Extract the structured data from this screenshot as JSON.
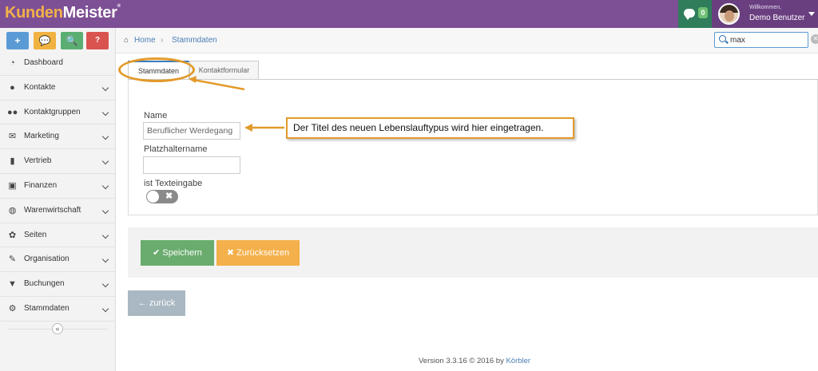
{
  "app": {
    "logo_part1": "Kunden",
    "logo_part2": "Meister",
    "logo_mark": "®"
  },
  "header": {
    "chat_count": "0",
    "welcome": "Willkommen,",
    "user_name": "Demo Benutzer"
  },
  "quick_actions": [
    {
      "label": "+"
    },
    {
      "label": "💬"
    },
    {
      "label": "🔍"
    },
    {
      "label": "?"
    }
  ],
  "sidebar": {
    "items": [
      {
        "label": "Dashboard",
        "icon": "dashboard-icon"
      },
      {
        "label": "Kontakte",
        "icon": "user-icon"
      },
      {
        "label": "Kontaktgruppen",
        "icon": "users-icon"
      },
      {
        "label": "Marketing",
        "icon": "envelope-icon"
      },
      {
        "label": "Vertrieb",
        "icon": "bar-chart-icon"
      },
      {
        "label": "Finanzen",
        "icon": "money-icon"
      },
      {
        "label": "Warenwirtschaft",
        "icon": "globe-icon"
      },
      {
        "label": "Seiten",
        "icon": "leaf-icon"
      },
      {
        "label": "Organisation",
        "icon": "edit-icon"
      },
      {
        "label": "Buchungen",
        "icon": "bookmark-icon"
      },
      {
        "label": "Stammdaten",
        "icon": "gears-icon"
      }
    ],
    "collapse_label": "«"
  },
  "breadcrumb": {
    "home": "Home",
    "separator": "›",
    "current": "Stammdaten"
  },
  "search": {
    "value": "max"
  },
  "tabs": [
    {
      "label": "Stammdaten",
      "active": true
    },
    {
      "label": "Kontaktformular",
      "active": false
    }
  ],
  "form": {
    "name_label": "Name",
    "name_value": "Beruflicher Werdegang",
    "placeholder_label": "Platzhaltername",
    "placeholder_value": "",
    "text_input_label": "ist Texteingabe",
    "text_input_enabled": false
  },
  "annotation": {
    "callout": "Der Titel des neuen Lebenslauftypus wird hier eingetragen."
  },
  "actions": {
    "save": "Speichern",
    "reset": "Zurücksetzen",
    "back": "zurück"
  },
  "footer": {
    "version": "Version 3.3.16 © 2016 by ",
    "brand": "Körbler"
  },
  "colors": {
    "header": "#7d4f95",
    "accent_orange": "#e29a2a",
    "save": "#6aac6e",
    "reset": "#f4b04a"
  }
}
